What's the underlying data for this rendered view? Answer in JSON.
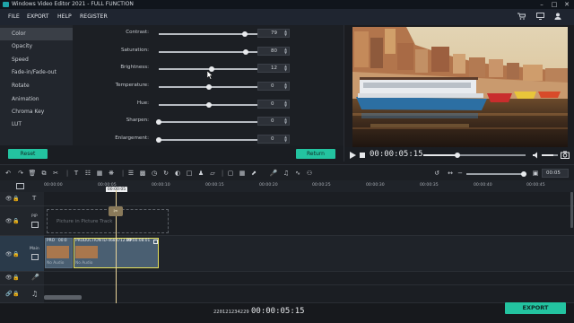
{
  "window": {
    "title": "Windows Video Editor 2021 - FULL FUNCTION",
    "controls": [
      "minimize",
      "maximize",
      "close"
    ]
  },
  "menu": {
    "items": [
      "FILE",
      "EXPORT",
      "HELP",
      "REGISTER"
    ],
    "right_icons": [
      "cart-icon",
      "monitor-icon",
      "user-icon"
    ]
  },
  "sidebar": {
    "items": [
      {
        "label": "Color",
        "active": true
      },
      {
        "label": "Opacity"
      },
      {
        "label": "Speed"
      },
      {
        "label": "Fade-in/Fade-out"
      },
      {
        "label": "Rotate"
      },
      {
        "label": "Animation"
      },
      {
        "label": "Chroma Key"
      },
      {
        "label": "LUT"
      }
    ]
  },
  "adjustments": {
    "sliders": [
      {
        "label": "Contrast:",
        "value": "79",
        "fraction": 0.86
      },
      {
        "label": "Saturation:",
        "value": "80",
        "fraction": 0.87
      },
      {
        "label": "Brightness:",
        "value": "12",
        "fraction": 0.53
      },
      {
        "label": "Temperature:",
        "value": "0",
        "fraction": 0.5
      },
      {
        "label": "Hue:",
        "value": "0",
        "fraction": 0.5
      },
      {
        "label": "Sharpen:",
        "value": "0",
        "fraction": 0.0
      },
      {
        "label": "Enlargement:",
        "value": "0",
        "fraction": 0.0
      }
    ],
    "reset_label": "Reset",
    "return_label": "Return"
  },
  "player": {
    "timecode": "00:00:05:15",
    "progress": 0.33,
    "volume": 0.7
  },
  "timeline": {
    "zoom_value": "00:05",
    "ruler": [
      "00:00:00",
      "00:00:05",
      "00:00:10",
      "00:00:15",
      "00:00:20",
      "00:00:25",
      "00:00:30",
      "00:00:35",
      "00:00:40",
      "00:00:45"
    ],
    "playhead_label": "00:00:05",
    "pip_track_label": "PIP",
    "pip_placeholder": "Picture in Picture Track",
    "main_track_label": "Main",
    "clips": [
      {
        "name": "PRO",
        "time": "00:0",
        "audio": "No Audio"
      },
      {
        "name": "PRODUCTION ID-4683712.MP",
        "time": "00:00:08:01",
        "audio": "No Audio"
      }
    ],
    "total_timecode": "220121234229",
    "current_timecode": "00:00:05:15"
  },
  "export_label": "EXPORT",
  "colors": {
    "accent": "#23c3a0",
    "selected_clip_border": "#e7e25c",
    "playhead": "#e9d49a"
  }
}
